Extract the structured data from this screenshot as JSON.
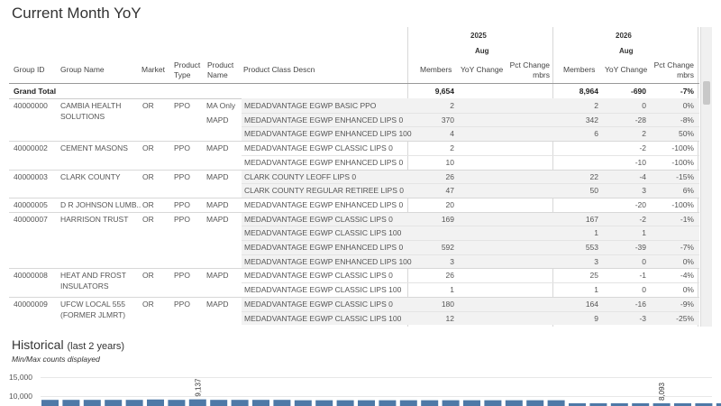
{
  "title": "Current Month YoY",
  "headers": {
    "group_id": "Group ID",
    "group_name": "Group Name",
    "market": "Market",
    "product_type_1": "Product",
    "product_type_2": "Type",
    "product_name_1": "Product",
    "product_name_2": "Name",
    "class": "Product Class Descn",
    "y2025": "2025",
    "y2026": "2026",
    "month_a": "Aug",
    "month_b": "Aug",
    "members_a": "Members",
    "yoy_a": "YoY Change",
    "pct_a_1": "Pct Change",
    "pct_a_2": "mbrs",
    "members_b": "Members",
    "yoy_b": "YoY Change",
    "pct_b_1": "Pct Change",
    "pct_b_2": "mbrs"
  },
  "grand": {
    "label": "Grand Total",
    "m25": "9,654",
    "m26": "8,964",
    "yoy": "-690",
    "pct": "-7%"
  },
  "rows": [
    {
      "gid": "40000000",
      "gname": "CAMBIA HEALTH",
      "gname2": "SOLUTIONS",
      "market": "OR",
      "ptype": "PPO",
      "pname": "MA Only",
      "cls": "MEDADVANTAGE EGWP BASIC PPO",
      "m25": "2",
      "m26": "2",
      "yoy": "0",
      "pct": "0%"
    },
    {
      "gid": "",
      "gname": "",
      "gname2": "",
      "market": "",
      "ptype": "",
      "pname": "MAPD",
      "cls": "MEDADVANTAGE EGWP ENHANCED LIPS 0",
      "m25": "370",
      "m26": "342",
      "yoy": "-28",
      "pct": "-8%"
    },
    {
      "gid": "",
      "gname": "",
      "gname2": "",
      "market": "",
      "ptype": "",
      "pname": "",
      "cls": "MEDADVANTAGE EGWP ENHANCED LIPS 100",
      "m25": "4",
      "m26": "6",
      "yoy": "2",
      "pct": "50%"
    },
    {
      "gid": "40000002",
      "gname": "CEMENT MASONS",
      "gname2": "",
      "market": "OR",
      "ptype": "PPO",
      "pname": "MAPD",
      "cls": "MEDADVANTAGE EGWP CLASSIC LIPS 0",
      "m25": "2",
      "m26": "",
      "yoy": "-2",
      "pct": "-100%"
    },
    {
      "gid": "",
      "gname": "",
      "gname2": "",
      "market": "",
      "ptype": "",
      "pname": "",
      "cls": "MEDADVANTAGE EGWP ENHANCED LIPS 0",
      "m25": "10",
      "m26": "",
      "yoy": "-10",
      "pct": "-100%"
    },
    {
      "gid": "40000003",
      "gname": "CLARK COUNTY",
      "gname2": "",
      "market": "OR",
      "ptype": "PPO",
      "pname": "MAPD",
      "cls": "CLARK COUNTY LEOFF LIPS 0",
      "m25": "26",
      "m26": "22",
      "yoy": "-4",
      "pct": "-15%"
    },
    {
      "gid": "",
      "gname": "",
      "gname2": "",
      "market": "",
      "ptype": "",
      "pname": "",
      "cls": "CLARK COUNTY REGULAR RETIREE LIPS 0",
      "m25": "47",
      "m26": "50",
      "yoy": "3",
      "pct": "6%"
    },
    {
      "gid": "40000005",
      "gname": "D R JOHNSON LUMB..",
      "gname2": "",
      "market": "OR",
      "ptype": "PPO",
      "pname": "MAPD",
      "cls": "MEDADVANTAGE EGWP ENHANCED LIPS 0",
      "m25": "20",
      "m26": "",
      "yoy": "-20",
      "pct": "-100%"
    },
    {
      "gid": "40000007",
      "gname": "HARRISON TRUST",
      "gname2": "",
      "market": "OR",
      "ptype": "PPO",
      "pname": "MAPD",
      "cls": "MEDADVANTAGE EGWP CLASSIC LIPS 0",
      "m25": "169",
      "m26": "167",
      "yoy": "-2",
      "pct": "-1%"
    },
    {
      "gid": "",
      "gname": "",
      "gname2": "",
      "market": "",
      "ptype": "",
      "pname": "",
      "cls": "MEDADVANTAGE EGWP CLASSIC LIPS 100",
      "m25": "",
      "m26": "1",
      "yoy": "1",
      "pct": ""
    },
    {
      "gid": "",
      "gname": "",
      "gname2": "",
      "market": "",
      "ptype": "",
      "pname": "",
      "cls": "MEDADVANTAGE EGWP ENHANCED LIPS 0",
      "m25": "592",
      "m26": "553",
      "yoy": "-39",
      "pct": "-7%"
    },
    {
      "gid": "",
      "gname": "",
      "gname2": "",
      "market": "",
      "ptype": "",
      "pname": "",
      "cls": "MEDADVANTAGE EGWP ENHANCED LIPS 100",
      "m25": "3",
      "m26": "3",
      "yoy": "0",
      "pct": "0%"
    },
    {
      "gid": "40000008",
      "gname": "HEAT AND FROST",
      "gname2": "INSULATORS",
      "market": "OR",
      "ptype": "PPO",
      "pname": "MAPD",
      "cls": "MEDADVANTAGE EGWP CLASSIC LIPS 0",
      "m25": "26",
      "m26": "25",
      "yoy": "-1",
      "pct": "-4%"
    },
    {
      "gid": "",
      "gname": "",
      "gname2": "",
      "market": "",
      "ptype": "",
      "pname": "",
      "cls": "MEDADVANTAGE EGWP CLASSIC LIPS 100",
      "m25": "1",
      "m26": "1",
      "yoy": "0",
      "pct": "0%"
    },
    {
      "gid": "40000009",
      "gname": "UFCW LOCAL 555",
      "gname2": "(FORMER JLMRT)",
      "market": "OR",
      "ptype": "PPO",
      "pname": "MAPD",
      "cls": "MEDADVANTAGE EGWP CLASSIC LIPS 0",
      "m25": "180",
      "m26": "164",
      "yoy": "-16",
      "pct": "-9%"
    },
    {
      "gid": "",
      "gname": "",
      "gname2": "",
      "market": "",
      "ptype": "",
      "pname": "",
      "cls": "MEDADVANTAGE EGWP CLASSIC LIPS 100",
      "m25": "12",
      "m26": "9",
      "yoy": "-3",
      "pct": "-25%"
    }
  ],
  "historical": {
    "title": "Historical",
    "title_suffix": "(last 2 years)",
    "subtitle": "Min/Max counts displayed",
    "y_ticks": [
      "15,000",
      "10,000"
    ],
    "max_label": "9,137",
    "min_label": "8,093",
    "bar_color": "#4e79a7"
  },
  "chart_data": {
    "type": "bar",
    "title": "Historical (last 2 years)",
    "ylim": [
      0,
      15000
    ],
    "annotations": [
      {
        "label": "9,137",
        "value": 9137
      },
      {
        "label": "8,093",
        "value": 8093
      }
    ],
    "values": [
      9000,
      9000,
      9000,
      9000,
      9000,
      9100,
      9000,
      9137,
      9000,
      9000,
      9000,
      9000,
      8900,
      8900,
      8900,
      8900,
      8900,
      8900,
      8900,
      8900,
      8900,
      8900,
      8900,
      8900,
      8900,
      8100,
      8100,
      8100,
      8100,
      8093,
      8100,
      8100,
      8100,
      8100
    ]
  }
}
